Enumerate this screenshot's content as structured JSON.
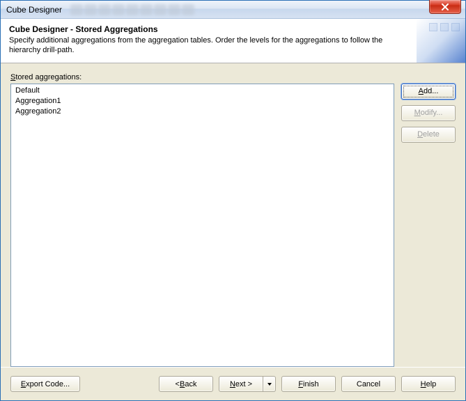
{
  "window": {
    "title": "Cube Designer"
  },
  "header": {
    "title": "Cube Designer - Stored Aggregations",
    "subtitle": "Specify additional aggregations from the aggregation tables. Order the levels for the aggregations to follow the hierarchy drill-path."
  },
  "list": {
    "label_pre": "S",
    "label_rest": "tored aggregations:",
    "items": [
      "Default",
      "Aggregation1",
      "Aggregation2"
    ]
  },
  "side_buttons": {
    "add_pre": "A",
    "add_rest": "dd...",
    "modify_pre": "M",
    "modify_rest": "odify...",
    "delete_pre": "D",
    "delete_rest": "elete"
  },
  "footer": {
    "export_pre": "E",
    "export_rest": "xport Code...",
    "back_lt": "< ",
    "back_pre": "B",
    "back_rest": "ack",
    "next_pre": "N",
    "next_rest": "ext >",
    "finish_pre": "F",
    "finish_rest": "inish",
    "cancel": "Cancel",
    "help_pre": "H",
    "help_rest": "elp"
  }
}
